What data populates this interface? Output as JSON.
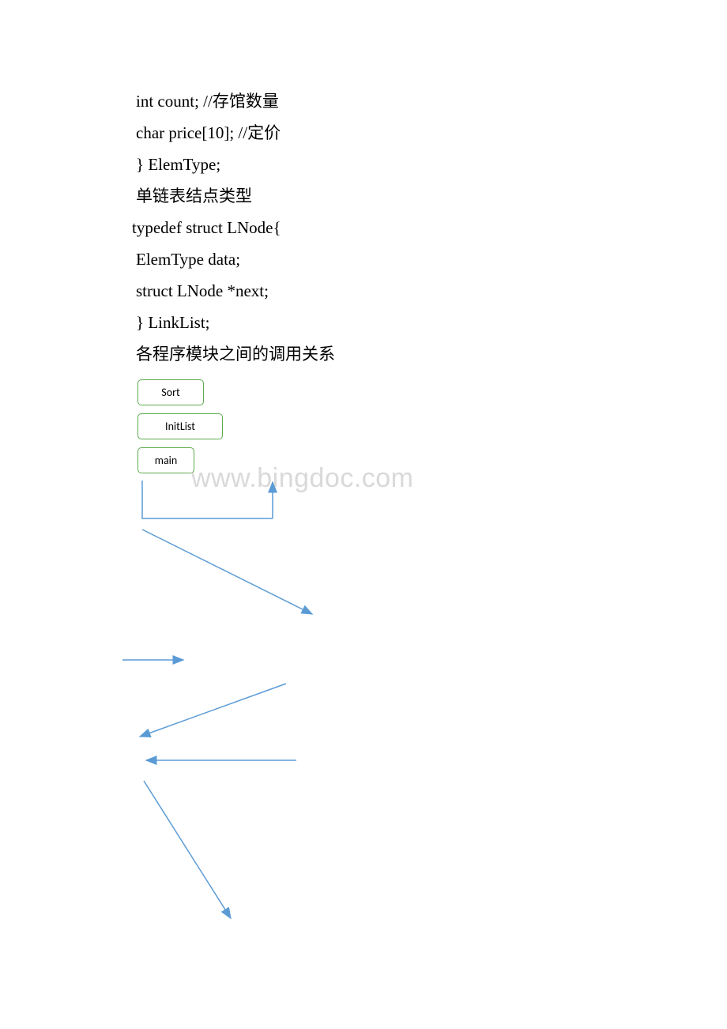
{
  "code": {
    "line1": "int count; //存馆数量",
    "line2": "char price[10]; //定价",
    "line3": "} ElemType;",
    "line4": "单链表结点类型",
    "line5": "typedef struct LNode{",
    "line6": "ElemType data;",
    "line7": "struct LNode *next;",
    "line8": "} LinkList;",
    "line9": "各程序模块之间的调用关系"
  },
  "boxes": {
    "sort": "Sort",
    "initlist": "InitList",
    "main": "main"
  },
  "watermark": "www.bingdoc.com",
  "diagram": {
    "arrows": [
      {
        "from": "main",
        "to": "right-up",
        "color": "#5b9bd5"
      },
      {
        "from": "left",
        "to": "right-down",
        "color": "#5b9bd5"
      },
      {
        "from": "left",
        "to": "right-short",
        "color": "#5b9bd5"
      },
      {
        "from": "right",
        "to": "left-down",
        "color": "#5b9bd5"
      },
      {
        "from": "right",
        "to": "left-straight",
        "color": "#5b9bd5"
      },
      {
        "from": "top",
        "to": "bottom-right",
        "color": "#5b9bd5"
      }
    ]
  }
}
